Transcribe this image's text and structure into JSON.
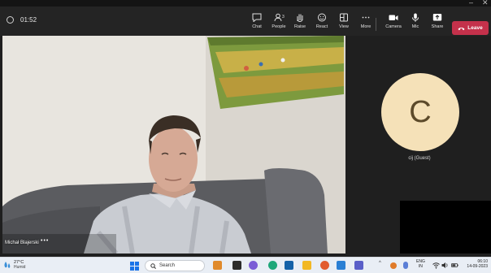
{
  "window": {
    "controls": [
      "–",
      "✕"
    ]
  },
  "toolbar": {
    "timer": "01:52",
    "buttons": [
      {
        "label": "Chat",
        "icon": "chat-icon"
      },
      {
        "label": "People",
        "icon": "people-icon",
        "count": "3"
      },
      {
        "label": "Raise",
        "icon": "raise-hand-icon"
      },
      {
        "label": "React",
        "icon": "react-icon"
      },
      {
        "label": "View",
        "icon": "view-icon"
      },
      {
        "label": "More",
        "icon": "more-icon"
      },
      {
        "label": "Camera",
        "icon": "camera-icon"
      },
      {
        "label": "Mic",
        "icon": "mic-icon"
      },
      {
        "label": "Share",
        "icon": "share-icon"
      }
    ],
    "leave_label": "Leave"
  },
  "stage": {
    "main_participant_name": "Michał Blajerski",
    "name_menu": "•••",
    "guest_initial": "C",
    "guest_name": "cij (Guest)"
  },
  "taskbar": {
    "weather_temp": "27°C",
    "weather_desc": "Humid",
    "search_label": "Search",
    "tray_chevron": "^",
    "lang_line1": "ENG",
    "lang_line2": "IN",
    "clock_time": "06:10",
    "clock_date": "14-09-2023"
  },
  "colors": {
    "leave": "#c4314b",
    "avatar_bg": "#f5e1b8",
    "toolbar_bg": "#242424",
    "taskbar_bg": "#e9eef5"
  }
}
